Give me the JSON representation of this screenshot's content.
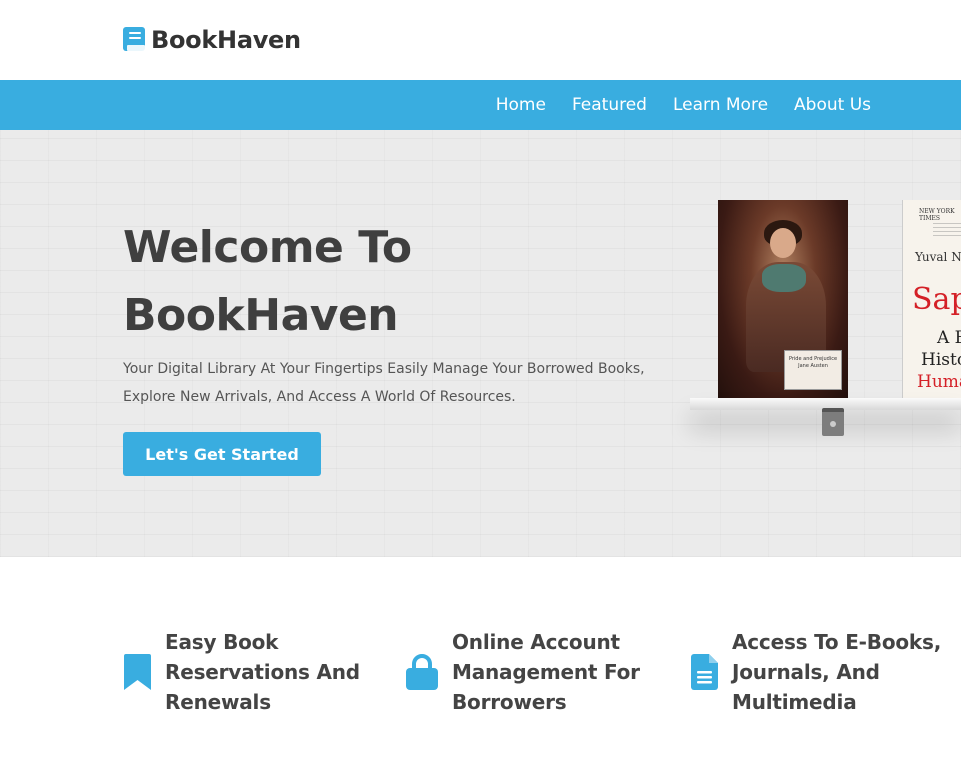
{
  "brand": {
    "name": "BookHaven",
    "icon": "book-icon",
    "accent_color": "#39ade0"
  },
  "nav": {
    "items": [
      {
        "label": "Home"
      },
      {
        "label": "Featured"
      },
      {
        "label": "Learn More"
      },
      {
        "label": "About Us"
      }
    ]
  },
  "hero": {
    "title_line1": "Welcome To",
    "title_line2": "BookHaven",
    "description_line1": "Your Digital Library At Your Fingertips Easily Manage Your Borrowed Books,",
    "description_line2": "Explore New Arrivals, And Access A World Of Resources.",
    "cta_label": "Let's Get Started",
    "books": [
      {
        "label_title": "Pride and Prejudice",
        "label_author": "Jane Austen"
      },
      {
        "header": "NEW YORK TIMES",
        "author": "Yuval Noah Harari",
        "title": "Sapiens",
        "subtitle_1": "A Brief",
        "subtitle_2": "History of",
        "subtitle_3": "Humankind"
      }
    ]
  },
  "features": [
    {
      "icon": "bookmark-icon",
      "line1": "Easy Book",
      "line2": "Reservations And",
      "line3": "Renewals"
    },
    {
      "icon": "lock-icon",
      "line1": "Online Account",
      "line2": "Management For",
      "line3": "Borrowers"
    },
    {
      "icon": "document-icon",
      "line1": "Access To E-Books,",
      "line2": "Journals, And",
      "line3": "Multimedia"
    }
  ]
}
